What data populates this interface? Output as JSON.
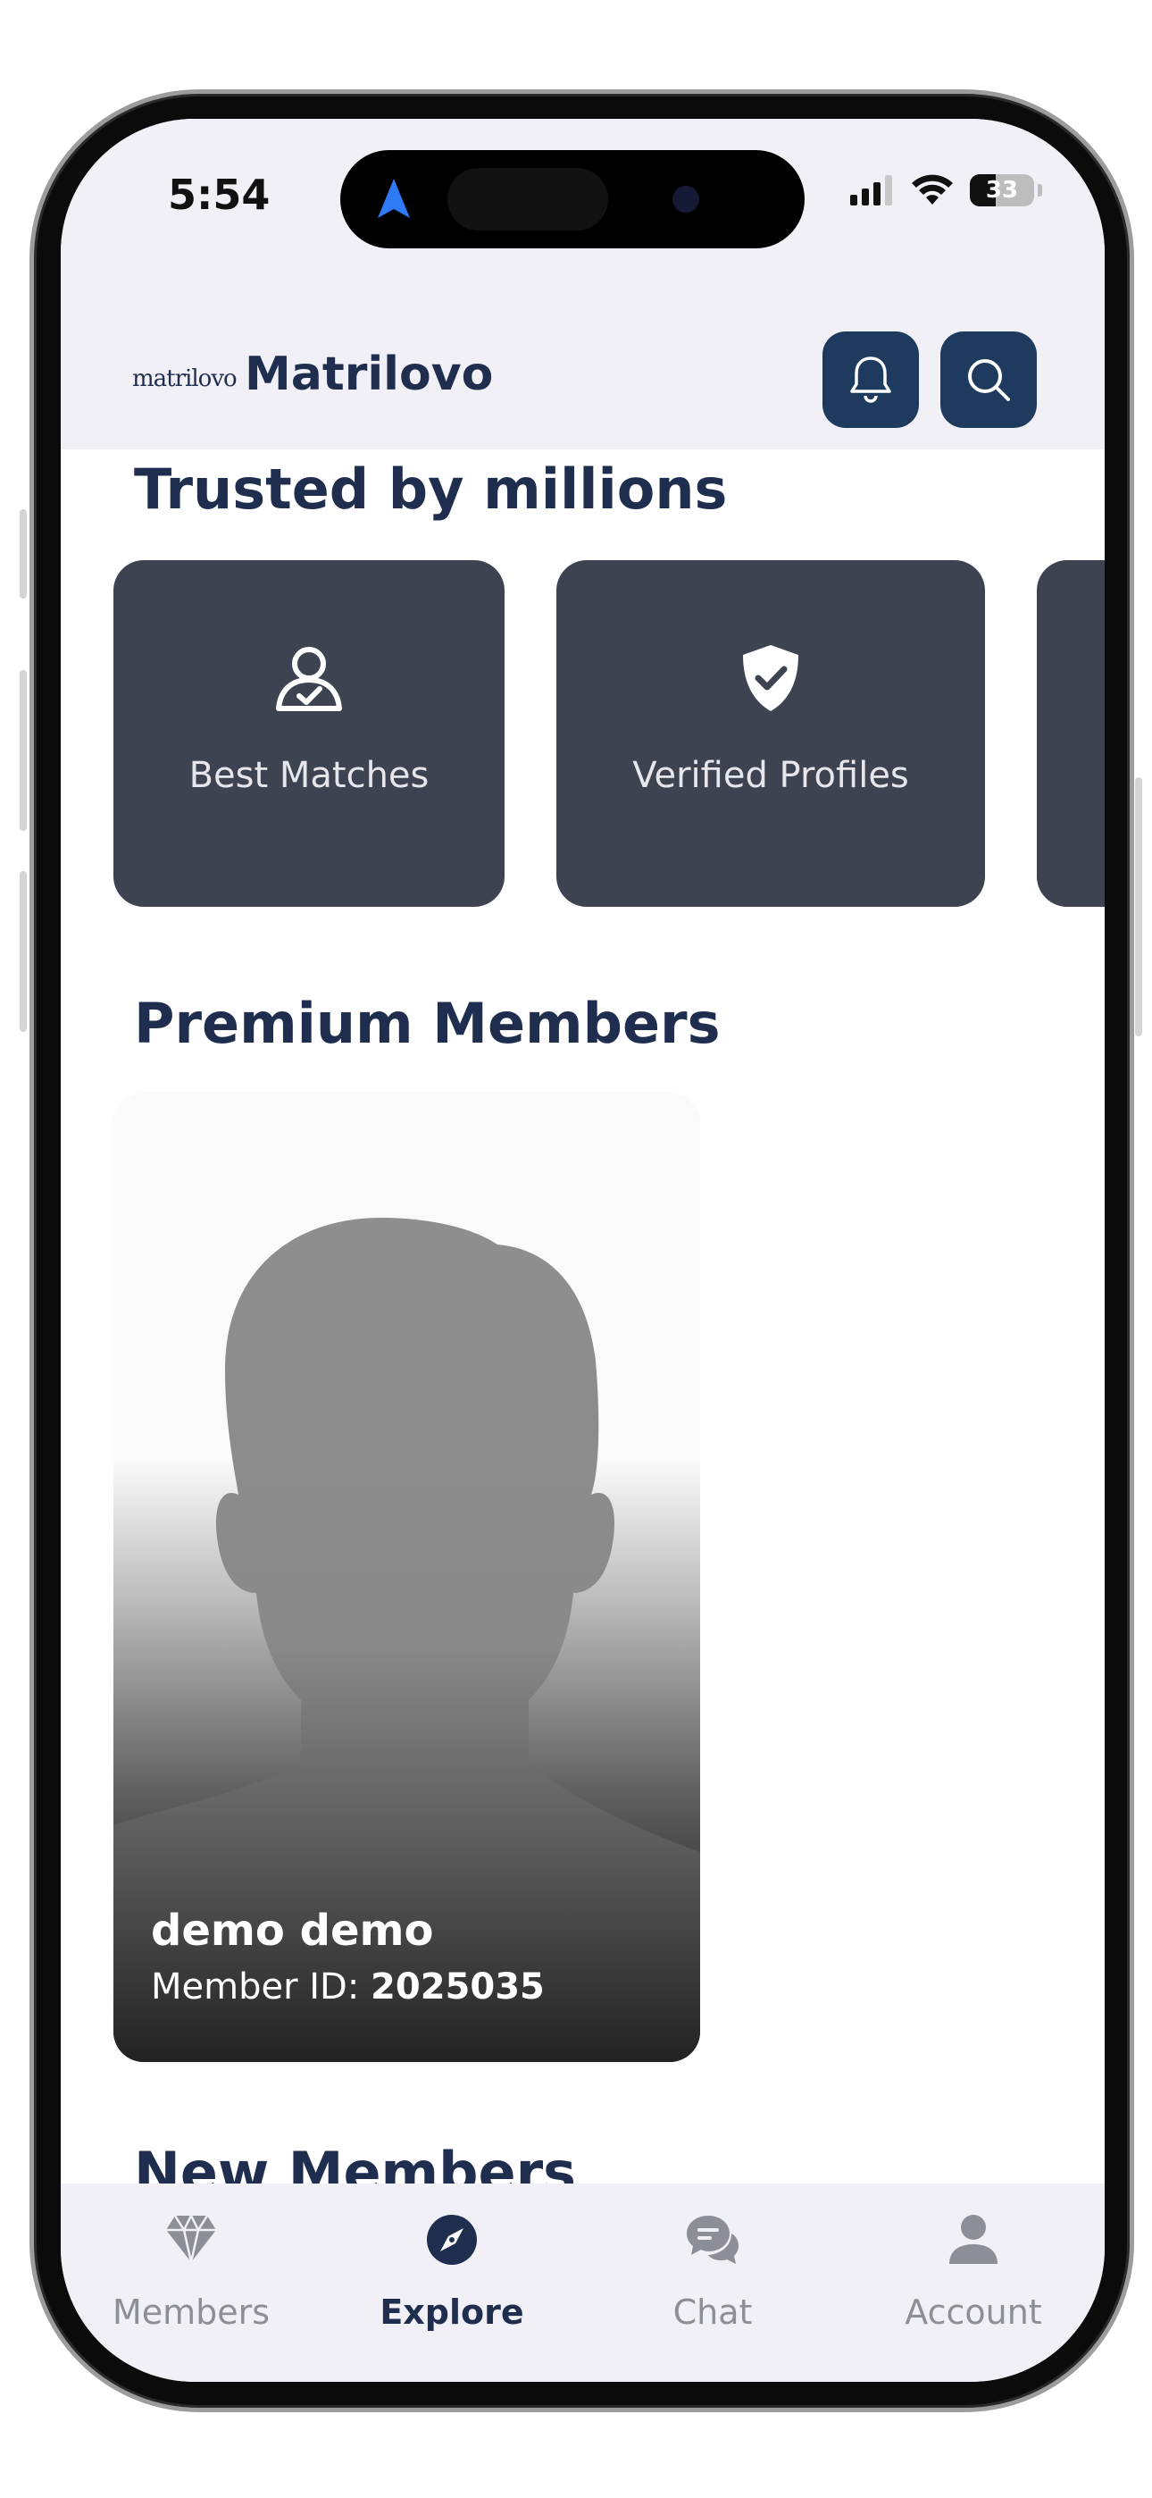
{
  "status_bar": {
    "time": "5:54",
    "battery": "33"
  },
  "header": {
    "logo_text": "matrilovo",
    "brand": "Matrilovo"
  },
  "sections": {
    "trusted": {
      "title": "Trusted by millions",
      "cards": [
        {
          "label": "Best Matches",
          "icon": "person-check-icon"
        },
        {
          "label": "Verified Profiles",
          "icon": "shield-check-icon"
        }
      ]
    },
    "premium": {
      "title": "Premium Members",
      "member": {
        "name": "demo demo",
        "id_label": "Member ID:",
        "id_value": "2025035"
      }
    },
    "new_members": {
      "title": "New Members"
    }
  },
  "tabs": [
    {
      "label": "Members",
      "icon": "diamond-icon",
      "active": false
    },
    {
      "label": "Explore",
      "icon": "compass-icon",
      "active": true
    },
    {
      "label": "Chat",
      "icon": "chat-icon",
      "active": false
    },
    {
      "label": "Account",
      "icon": "user-icon",
      "active": false
    }
  ],
  "colors": {
    "primary": "#1f2d4e",
    "button": "#1f3a5f",
    "card": "#3e4351",
    "background": "#f0f0f6"
  }
}
